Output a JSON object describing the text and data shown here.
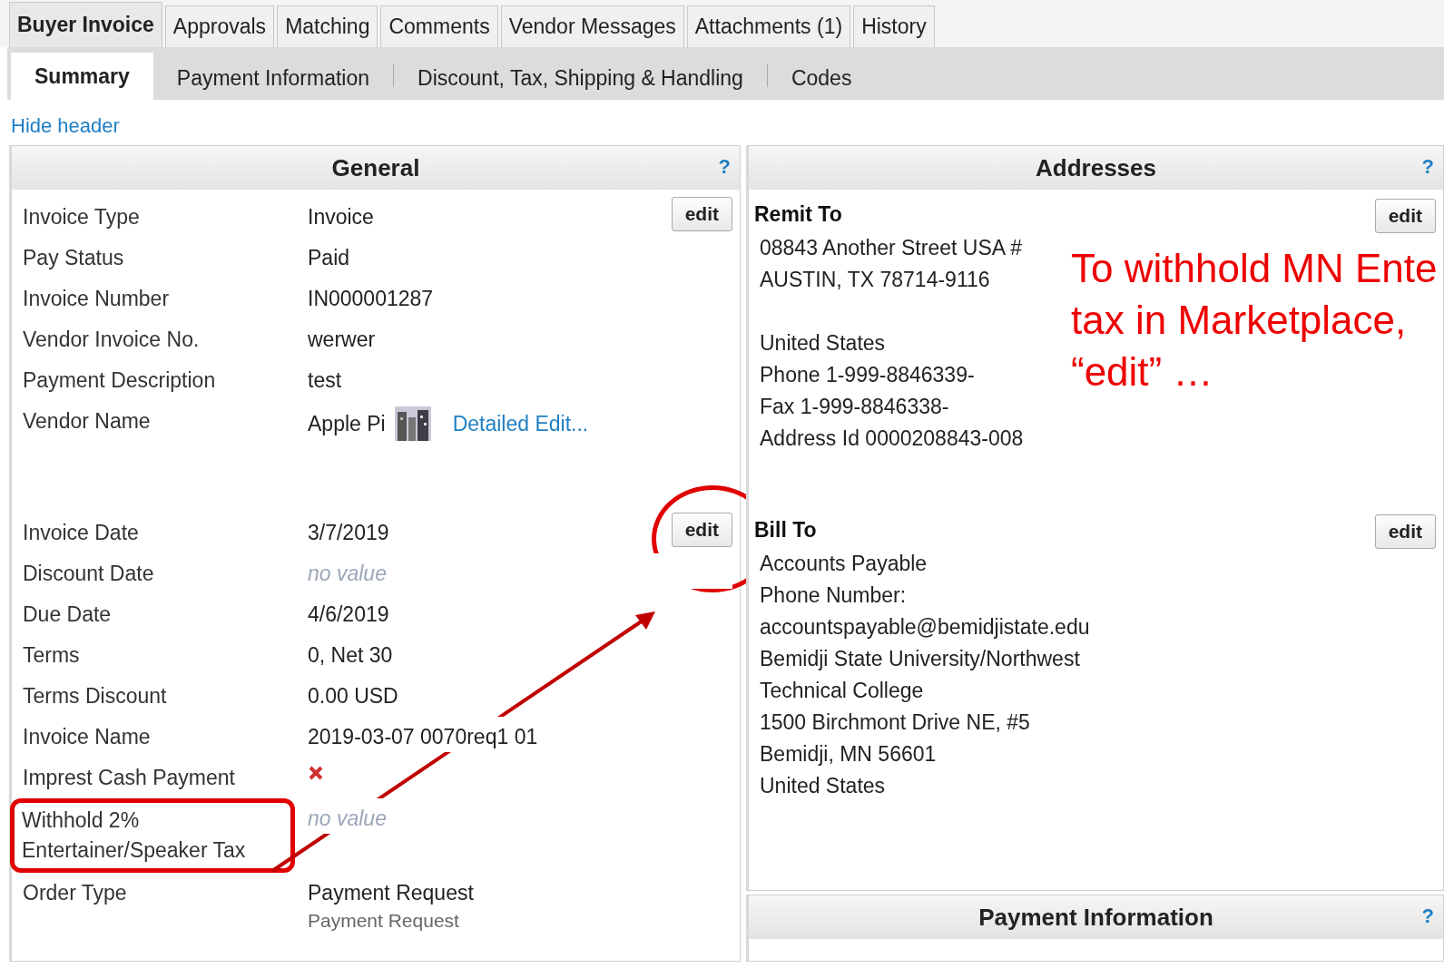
{
  "tabs": [
    {
      "label": "Buyer Invoice",
      "selected": true
    },
    {
      "label": "Approvals",
      "selected": false
    },
    {
      "label": "Matching",
      "selected": false
    },
    {
      "label": "Comments",
      "selected": false
    },
    {
      "label": "Vendor Messages",
      "selected": false
    },
    {
      "label": "Attachments (1)",
      "selected": false
    },
    {
      "label": "History",
      "selected": false
    }
  ],
  "subtabs": [
    {
      "label": "Summary",
      "selected": true
    },
    {
      "label": "Payment Information",
      "selected": false
    },
    {
      "label": "Discount, Tax, Shipping & Handling",
      "selected": false
    },
    {
      "label": "Codes",
      "selected": false
    }
  ],
  "hide_header_link": "Hide header",
  "general": {
    "title": "General",
    "help": "?",
    "groups": [
      {
        "edit": "edit",
        "circled": false,
        "fields": [
          {
            "kind": "text",
            "label": "Invoice Type",
            "value": "Invoice"
          },
          {
            "kind": "text",
            "label": "Pay Status",
            "value": "Paid"
          },
          {
            "kind": "text",
            "label": "Invoice Number",
            "value": "IN000001287"
          },
          {
            "kind": "text",
            "label": "Vendor Invoice No.",
            "value": "werwer"
          },
          {
            "kind": "text",
            "label": "Payment Description",
            "value": "test"
          },
          {
            "kind": "vendor",
            "label": "Vendor Name",
            "value": "Apple Pi",
            "link": "Detailed Edit..."
          }
        ]
      },
      {
        "edit": "edit",
        "circled": true,
        "fields": [
          {
            "kind": "text",
            "label": "Invoice Date",
            "value": "3/7/2019"
          },
          {
            "kind": "empty",
            "label": "Discount Date",
            "value": "no value"
          },
          {
            "kind": "text",
            "label": "Due Date",
            "value": "4/6/2019"
          },
          {
            "kind": "text",
            "label": "Terms",
            "value": "0, Net 30"
          },
          {
            "kind": "text",
            "label": "Terms Discount",
            "value": "0.00 USD"
          },
          {
            "kind": "text",
            "label": "Invoice Name",
            "value": "2019-03-07 0070req1 01"
          },
          {
            "kind": "boolean",
            "label": "Imprest Cash Payment",
            "checked": false
          },
          {
            "kind": "empty",
            "label": "Withhold 2% Entertainer/Speaker Tax",
            "value": "no value",
            "highlighted": true
          },
          {
            "kind": "text",
            "label": "Order Type",
            "value": "Payment Request",
            "subvalue": "Payment Request"
          }
        ]
      }
    ]
  },
  "addresses": {
    "title": "Addresses",
    "help": "?",
    "sections": [
      {
        "title": "Remit To",
        "edit": "edit",
        "lines": [
          "08843 Another Street USA #",
          "AUSTIN, TX 78714-9116",
          "United States",
          "Phone 1-999-8846339-",
          "Fax 1-999-8846338-",
          "Address Id 0000208843-008"
        ]
      },
      {
        "title": "Bill To",
        "edit": "edit",
        "lines": [
          "Accounts Payable",
          "Phone Number:",
          "accountspayable@bemidjistate.edu",
          "Bemidji State University/Northwest",
          "Technical College",
          "1500 Birchmont Drive NE, #5",
          "Bemidji, MN 56601",
          "United States"
        ]
      }
    ]
  },
  "payment_information": {
    "title": "Payment Information",
    "help": "?"
  },
  "annotation": {
    "lines": [
      "To withhold MN Ente",
      "tax in Marketplace,",
      "“edit” …"
    ]
  }
}
